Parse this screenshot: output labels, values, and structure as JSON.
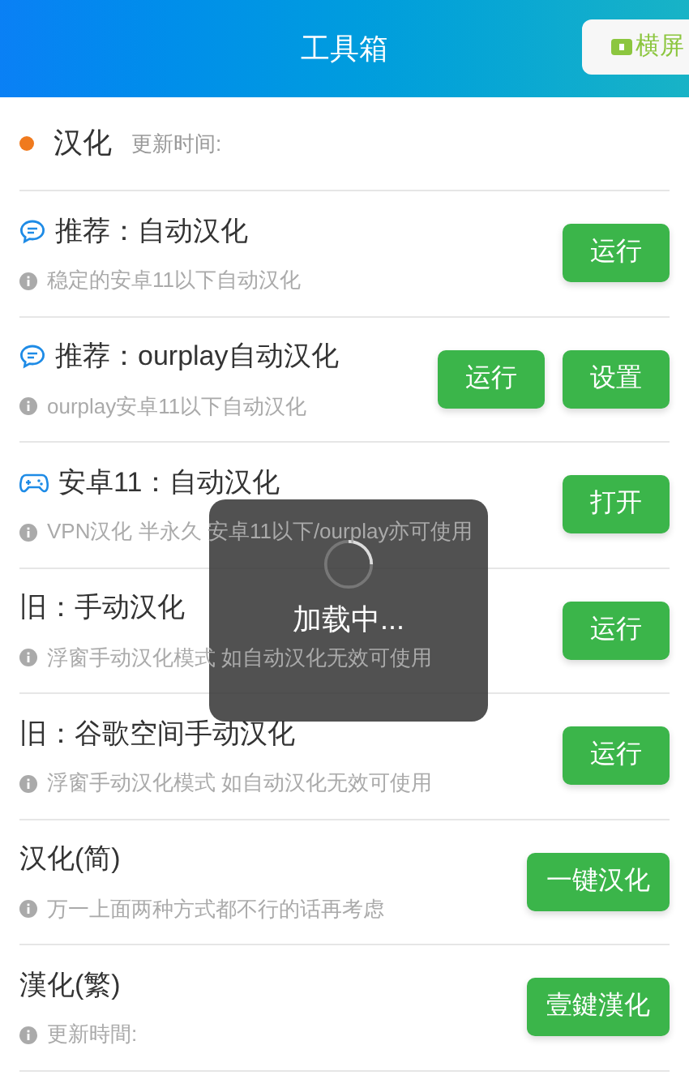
{
  "header": {
    "title": "工具箱",
    "landscape_button": "横屏"
  },
  "section": {
    "title": "汉化",
    "subtitle": "更新时间:",
    "color": "#f07a1e"
  },
  "items": [
    {
      "kind": "chat",
      "title": "推荐：自动汉化",
      "desc": "稳定的安卓11以下自动汉化",
      "buttons": [
        "运行"
      ]
    },
    {
      "kind": "chat",
      "title": "推荐：ourplay自动汉化",
      "desc": "ourplay安卓11以下自动汉化",
      "buttons": [
        "运行",
        "设置"
      ]
    },
    {
      "kind": "game",
      "title": "安卓11：自动汉化",
      "desc": "VPN汉化 半永久 安卓11以下/ourplay亦可使用",
      "buttons": [
        "打开"
      ]
    },
    {
      "kind": "plain",
      "title": "旧：手动汉化",
      "desc": "浮窗手动汉化模式 如自动汉化无效可使用",
      "buttons": [
        "运行"
      ]
    },
    {
      "kind": "plain",
      "title": "旧：谷歌空间手动汉化",
      "desc": "浮窗手动汉化模式 如自动汉化无效可使用",
      "buttons": [
        "运行"
      ]
    },
    {
      "kind": "plain",
      "title": "汉化(简)",
      "desc": "万一上面两种方式都不行的话再考虑",
      "buttons": [
        "一键汉化"
      ]
    },
    {
      "kind": "plain",
      "title": "漢化(繁)",
      "desc": "更新時間:",
      "buttons": [
        "壹鍵漢化"
      ]
    }
  ],
  "loading": {
    "text": "加载中..."
  }
}
